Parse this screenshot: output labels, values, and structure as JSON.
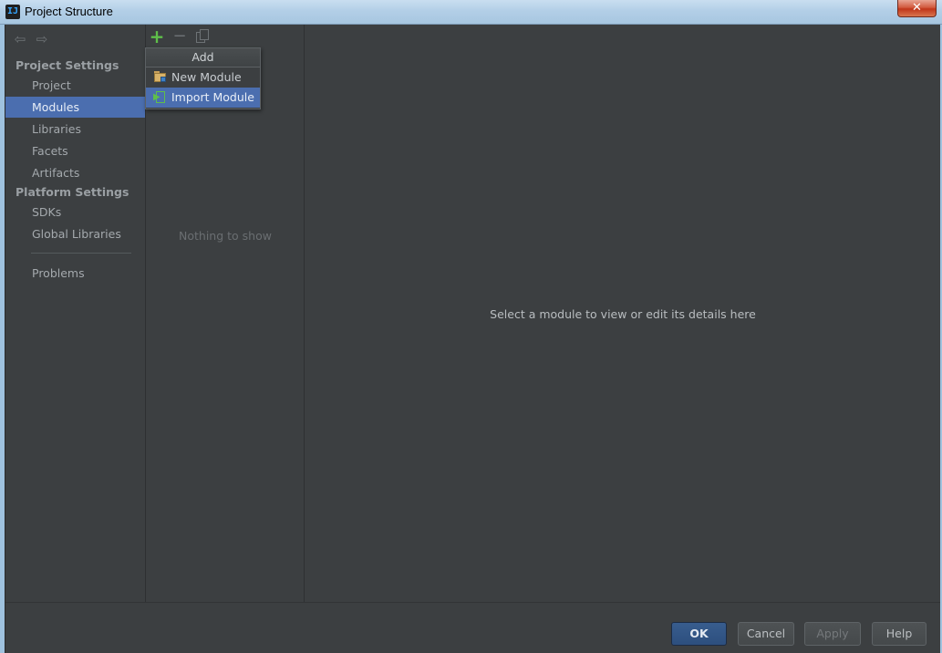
{
  "window": {
    "title": "Project Structure",
    "close_glyph": "✕"
  },
  "nav": {
    "back_glyph": "⇦",
    "forward_glyph": "⇨",
    "sections": [
      {
        "label": "Project Settings"
      },
      {
        "label": "Platform Settings"
      }
    ],
    "items": [
      {
        "label": "Project",
        "selected": false
      },
      {
        "label": "Modules",
        "selected": true
      },
      {
        "label": "Libraries",
        "selected": false
      },
      {
        "label": "Facets",
        "selected": false
      },
      {
        "label": "Artifacts",
        "selected": false
      },
      {
        "label": "SDKs",
        "selected": false
      },
      {
        "label": "Global Libraries",
        "selected": false
      },
      {
        "label": "Problems",
        "selected": false
      }
    ]
  },
  "middle": {
    "toolbar": {
      "add_glyph": "+",
      "remove_glyph": "−"
    },
    "empty_text": "Nothing to show"
  },
  "popup": {
    "header": "Add",
    "items": [
      {
        "label": "New Module",
        "icon": "folder-module-icon"
      },
      {
        "label": "Import Module",
        "icon": "import-module-icon",
        "highlighted": true
      }
    ]
  },
  "details": {
    "placeholder": "Select a module to view or edit its details here"
  },
  "buttons": {
    "ok": "OK",
    "cancel": "Cancel",
    "apply": "Apply",
    "help": "Help"
  },
  "colors": {
    "background": "#3c3f41",
    "selection": "#4b6eaf",
    "add_green": "#5fbf4a",
    "ok_blue": "#2d4f7e"
  }
}
